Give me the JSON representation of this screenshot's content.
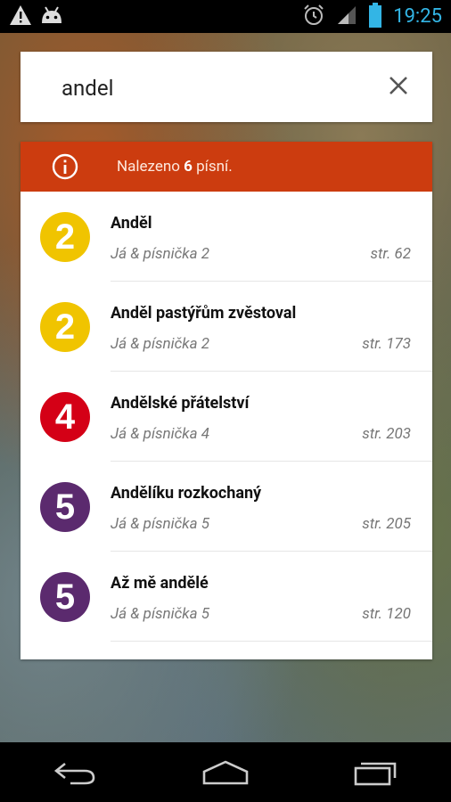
{
  "status_bar": {
    "time": "19:25",
    "icons": [
      "warning-icon",
      "android-icon",
      "alarm-icon",
      "signal-icon",
      "battery-icon"
    ]
  },
  "search": {
    "query": "andel",
    "clear_icon": "close-icon"
  },
  "results_banner": {
    "prefix": "Nalezeno ",
    "count": "6",
    "suffix": " písní.",
    "icon": "info-icon",
    "color": "#cc3c0f"
  },
  "results": [
    {
      "badge": "2",
      "badge_color": "#f0c400",
      "title": "Anděl",
      "book": "Já & písnička 2",
      "page": "str. 62"
    },
    {
      "badge": "2",
      "badge_color": "#f0c400",
      "title": "Anděl pastýřům zvěstoval",
      "book": "Já & písnička 2",
      "page": "str. 173"
    },
    {
      "badge": "4",
      "badge_color": "#d40016",
      "title": "Andělské přátelství",
      "book": "Já & písnička 4",
      "page": "str. 203"
    },
    {
      "badge": "5",
      "badge_color": "#5b2a6e",
      "title": "Andělíku rozkochaný",
      "book": "Já & písnička 5",
      "page": "str. 205"
    },
    {
      "badge": "5",
      "badge_color": "#5b2a6e",
      "title": "Až mě andělé",
      "book": "Já & písnička 5",
      "page": "str. 120"
    }
  ],
  "nav_bar": {
    "buttons": [
      "back-icon",
      "home-icon",
      "recent-apps-icon"
    ]
  }
}
